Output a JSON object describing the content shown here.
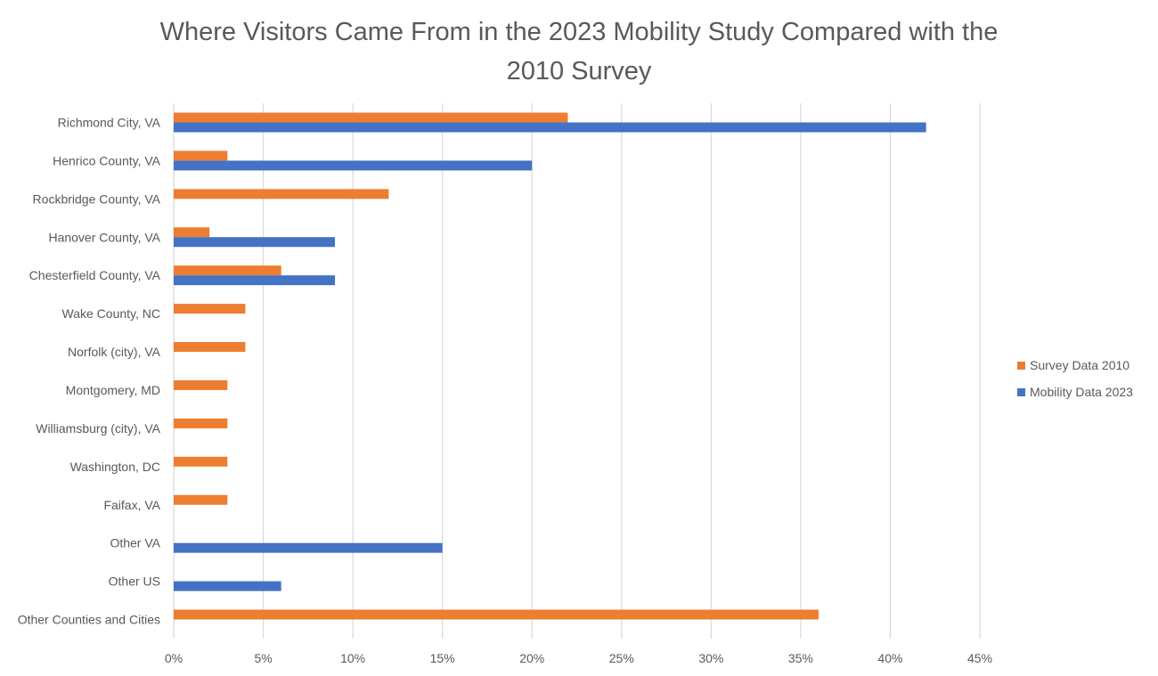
{
  "chart_data": {
    "type": "bar",
    "orientation": "horizontal",
    "title": "Where Visitors Came From in the 2023 Mobility Study Compared with the 2010 Survey",
    "title_lines": [
      "Where Visitors Came From in the 2023 Mobility Study Compared with the",
      "2010 Survey"
    ],
    "xlabel": "",
    "ylabel": "",
    "xlim": [
      0,
      45
    ],
    "x_ticks": [
      0,
      5,
      10,
      15,
      20,
      25,
      30,
      35,
      40,
      45
    ],
    "x_tick_labels": [
      "0%",
      "5%",
      "10%",
      "15%",
      "20%",
      "25%",
      "30%",
      "35%",
      "40%",
      "45%"
    ],
    "grid": "vertical",
    "legend_position": "right",
    "categories": [
      "Richmond City, VA",
      "Henrico County, VA",
      "Rockbridge County, VA",
      "Hanover County, VA",
      "Chesterfield County, VA",
      "Wake County, NC",
      "Norfolk (city), VA",
      "Montgomery, MD",
      "Williamsburg (city), VA",
      "Washington, DC",
      "Faifax, VA",
      "Other VA",
      "Other US",
      "Other Counties and Cities"
    ],
    "series": [
      {
        "name": "Survey Data 2010",
        "color": "#ED7D31",
        "values": [
          22,
          3,
          12,
          2,
          6,
          4,
          4,
          3,
          3,
          3,
          3,
          null,
          null,
          36
        ]
      },
      {
        "name": "Mobility Data 2023",
        "color": "#4472C4",
        "values": [
          42,
          20,
          null,
          9,
          9,
          null,
          null,
          null,
          null,
          null,
          null,
          15,
          6,
          null
        ]
      }
    ],
    "legend": [
      "Survey Data 2010",
      "Mobility Data 2023"
    ],
    "unit": "%"
  }
}
